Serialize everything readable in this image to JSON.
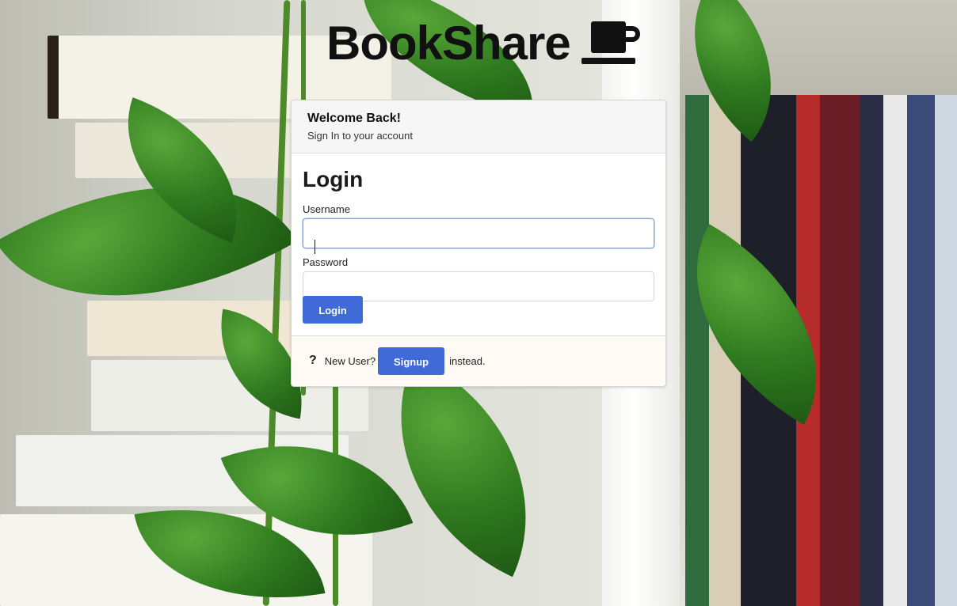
{
  "app": {
    "brand_name": "BookShare",
    "brand_icon": "coffee-mug-icon"
  },
  "card": {
    "header": {
      "title": "Welcome Back!",
      "subtitle": "Sign In to your account"
    },
    "form": {
      "heading": "Login",
      "username_label": "Username",
      "username_value": "",
      "password_label": "Password",
      "password_value": "",
      "submit_label": "Login"
    },
    "footer": {
      "icon": "question-mark-icon",
      "prompt": "New User?",
      "signup_label": "Signup",
      "suffix": "instead."
    }
  },
  "colors": {
    "primary_button": "#3f6ad8",
    "footer_background": "#fffaf3",
    "header_background": "#f6f6f6"
  }
}
